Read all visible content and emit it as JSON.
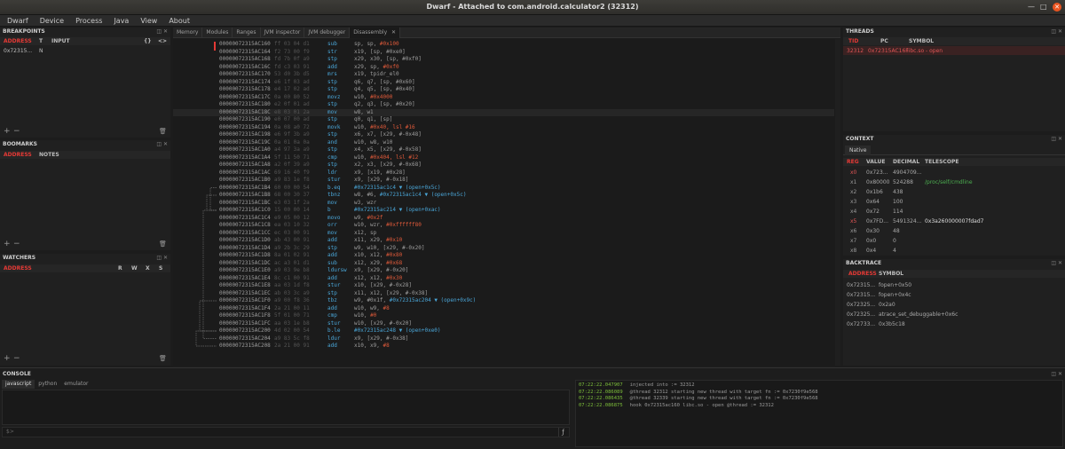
{
  "window": {
    "title": "Dwarf - Attached to com.android.calculator2 (32312)"
  },
  "menu": [
    "Dwarf",
    "Device",
    "Process",
    "Java",
    "View",
    "About"
  ],
  "breakpoints": {
    "title": "BREAKPOINTS",
    "cols": [
      "ADDRESS",
      "T",
      "INPUT"
    ],
    "rows": [
      {
        "address": "0x72315...",
        "t": "N"
      }
    ],
    "add": "+",
    "remove": "−"
  },
  "bookmarks": {
    "title": "BOOMARKS",
    "cols": [
      "ADDRESS",
      "NOTES"
    ],
    "add": "+",
    "remove": "−"
  },
  "watchers": {
    "title": "WATCHERS",
    "cols": [
      "ADDRESS",
      "R",
      "W",
      "X",
      "S"
    ],
    "add": "+",
    "remove": "−"
  },
  "tabs": [
    "Memory",
    "Modules",
    "Ranges",
    "JVM inspector",
    "JVM debugger",
    "Disassembly"
  ],
  "disassembly": [
    {
      "addr": "00000072315AC160",
      "bytes": "ff 03 04 d1",
      "mn": "sub",
      "op": "sp, sp, ",
      "imm": "#0x100",
      "tail": ""
    },
    {
      "addr": "00000072315AC164",
      "bytes": "f2 73 00 f9",
      "mn": "str",
      "op": "x19, [sp, #0xe0]",
      "imm": "",
      "tail": ""
    },
    {
      "addr": "00000072315AC168",
      "bytes": "fd 7b 0f a9",
      "mn": "stp",
      "op": "x29, x30, [sp, #0xf0]",
      "imm": "",
      "tail": ""
    },
    {
      "addr": "00000072315AC16C",
      "bytes": "fd c3 03 91",
      "mn": "add",
      "op": "x29, sp, ",
      "imm": "#0xf0",
      "tail": ""
    },
    {
      "addr": "00000072315AC170",
      "bytes": "53 d0 3b d5",
      "mn": "mrs",
      "op": "x19, tpidr_el0",
      "imm": "",
      "tail": ""
    },
    {
      "addr": "00000072315AC174",
      "bytes": "e6 1f 03 ad",
      "mn": "stp",
      "op": "q6, q7, [sp, #0x60]",
      "imm": "",
      "tail": ""
    },
    {
      "addr": "00000072315AC178",
      "bytes": "e4 17 02 ad",
      "mn": "stp",
      "op": "q4, q5, [sp, #0x40]",
      "imm": "",
      "tail": ""
    },
    {
      "addr": "00000072315AC17C",
      "bytes": "0a 00 80 52",
      "mn": "movz",
      "op": "w10, ",
      "imm": "#0x4000",
      "tail": ""
    },
    {
      "addr": "00000072315AC180",
      "bytes": "e2 0f 01 ad",
      "mn": "stp",
      "op": "q2, q3, [sp, #0x20]",
      "imm": "",
      "tail": ""
    },
    {
      "addr": "00000072315AC18C",
      "bytes": "e8 03 01 2a",
      "mn": "mov",
      "op": "w8, w1",
      "imm": "",
      "tail": ""
    },
    {
      "addr": "00000072315AC190",
      "bytes": "e0 07 00 ad",
      "mn": "stp",
      "op": "q0, q1, [sp]",
      "imm": "",
      "tail": ""
    },
    {
      "addr": "00000072315AC194",
      "bytes": "0a 08 a0 72",
      "mn": "movk",
      "op": "w10, ",
      "imm": "#0x40, lsl #16",
      "tail": ""
    },
    {
      "addr": "00000072315AC198",
      "bytes": "e6 9f 3b a9",
      "mn": "stp",
      "op": "x6, x7, [x29, #-0x48]",
      "imm": "",
      "tail": ""
    },
    {
      "addr": "00000072315AC19C",
      "bytes": "0a 01 0a 0a",
      "mn": "and",
      "op": "w10, w8, w10",
      "imm": "",
      "tail": ""
    },
    {
      "addr": "00000072315AC1A0",
      "bytes": "a4 97 3a a9",
      "mn": "stp",
      "op": "x4, x5, [x29, #-0x58]",
      "imm": "",
      "tail": ""
    },
    {
      "addr": "00000072315AC1A4",
      "bytes": "5f 11 50 71",
      "mn": "cmp",
      "op": "w10, ",
      "imm": "#0x404, lsl #12",
      "tail": ""
    },
    {
      "addr": "00000072315AC1A8",
      "bytes": "a2 0f 39 a9",
      "mn": "stp",
      "op": "x2, x3, [x29, #-0x68]",
      "imm": "",
      "tail": ""
    },
    {
      "addr": "00000072315AC1AC",
      "bytes": "69 16 40 f9",
      "mn": "ldr",
      "op": "x9, [x19, #0x28]",
      "imm": "",
      "tail": ""
    },
    {
      "addr": "00000072315AC1B0",
      "bytes": "a9 83 1e f8",
      "mn": "stur",
      "op": "x9, [x29, #-0x18]",
      "imm": "",
      "tail": ""
    },
    {
      "addr": "00000072315AC1B4",
      "bytes": "60 00 00 54",
      "mn": "b.eq",
      "op": "",
      "imm": "",
      "tail": "#0x72315ac1c4 ▼ (open+0x5c)"
    },
    {
      "addr": "00000072315AC1B8",
      "bytes": "68 00 30 37",
      "mn": "tbnz",
      "op": "w8, #6, ",
      "imm": "",
      "tail": "#0x72315ac1c4 ▼ (open+0x5c)"
    },
    {
      "addr": "00000072315AC1BC",
      "bytes": "e3 03 1f 2a",
      "mn": "mov",
      "op": "w3, wzr",
      "imm": "",
      "tail": ""
    },
    {
      "addr": "00000072315AC1C0",
      "bytes": "15 00 00 14",
      "mn": "b",
      "op": "",
      "imm": "",
      "tail": "#0x72315ac214 ▼ (open+0xac)"
    },
    {
      "addr": "00000072315AC1C4",
      "bytes": "e9 05 00 12",
      "mn": "movo",
      "op": "w9, ",
      "imm": "#0x2f",
      "tail": ""
    },
    {
      "addr": "00000072315AC1C8",
      "bytes": "ea 03 10 32",
      "mn": "orr",
      "op": "w10, wzr, ",
      "imm": "#0xffffff80",
      "tail": ""
    },
    {
      "addr": "00000072315AC1CC",
      "bytes": "ec 03 00 91",
      "mn": "mov",
      "op": "x12, sp",
      "imm": "",
      "tail": ""
    },
    {
      "addr": "00000072315AC1D0",
      "bytes": "ab 43 00 91",
      "mn": "add",
      "op": "x11, x29, ",
      "imm": "#0x10",
      "tail": ""
    },
    {
      "addr": "00000072315AC1D4",
      "bytes": "a9 2b 3c 29",
      "mn": "stp",
      "op": "w9, w10, [x29, #-0x20]",
      "imm": "",
      "tail": ""
    },
    {
      "addr": "00000072315AC1D8",
      "bytes": "8a 01 02 91",
      "mn": "add",
      "op": "x10, x12, ",
      "imm": "#0x80",
      "tail": ""
    },
    {
      "addr": "00000072315AC1DC",
      "bytes": "ac a3 01 d1",
      "mn": "sub",
      "op": "x12, x29, ",
      "imm": "#0x68",
      "tail": ""
    },
    {
      "addr": "00000072315AC1E0",
      "bytes": "a9 03 9e b8",
      "mn": "ldursw",
      "op": "x9, [x29, #-0x20]",
      "imm": "",
      "tail": ""
    },
    {
      "addr": "00000072315AC1E4",
      "bytes": "8c c1 00 91",
      "mn": "add",
      "op": "x12, x12, ",
      "imm": "#0x30",
      "tail": ""
    },
    {
      "addr": "00000072315AC1E8",
      "bytes": "aa 03 1d f8",
      "mn": "stur",
      "op": "x10, [x29, #-0x28]",
      "imm": "",
      "tail": ""
    },
    {
      "addr": "00000072315AC1EC",
      "bytes": "ab 03 3c a9",
      "mn": "stp",
      "op": "x11, x12, [x29, #-0x38]",
      "imm": "",
      "tail": ""
    },
    {
      "addr": "00000072315AC1F0",
      "bytes": "a9 00 f8 36",
      "mn": "tbz",
      "op": "w9, #0x1f, ",
      "imm": "",
      "tail": "#0x72315ac204 ▼ (open+0x9c)"
    },
    {
      "addr": "00000072315AC1F4",
      "bytes": "2a 21 00 11",
      "mn": "add",
      "op": "w10, w9, ",
      "imm": "#8",
      "tail": ""
    },
    {
      "addr": "00000072315AC1F8",
      "bytes": "5f 01 00 71",
      "mn": "cmp",
      "op": "w10, ",
      "imm": "#0",
      "tail": ""
    },
    {
      "addr": "00000072315AC1FC",
      "bytes": "aa 03 1e b8",
      "mn": "stur",
      "op": "w10, [x29, #-0x20]",
      "imm": "",
      "tail": ""
    },
    {
      "addr": "00000072315AC200",
      "bytes": "4d 02 00 54",
      "mn": "b.le",
      "op": "",
      "imm": "",
      "tail": "#0x72315ac248 ▼ (open+0xe0)"
    },
    {
      "addr": "00000072315AC204",
      "bytes": "a9 83 5c f8",
      "mn": "ldur",
      "op": "x9, [x29, #-0x38]",
      "imm": "",
      "tail": ""
    },
    {
      "addr": "00000072315AC208",
      "bytes": "2a 21 00 91",
      "mn": "add",
      "op": "x10, x9, ",
      "imm": "#8",
      "tail": ""
    }
  ],
  "threads": {
    "title": "THREADS",
    "cols": [
      "TID",
      "PC",
      "SYMBOL"
    ],
    "rows": [
      {
        "tid": "32312",
        "pc": "0x72315AC16F",
        "symbol": "libc.so - open"
      }
    ]
  },
  "context": {
    "title": "CONTEXT",
    "tab": "Native",
    "cols": [
      "REG",
      "VALUE",
      "DECIMAL",
      "TELESCOPE"
    ],
    "rows": [
      {
        "reg": "x0",
        "value": "0x723...",
        "dec": "4904709...",
        "tel": "",
        "red": true
      },
      {
        "reg": "x1",
        "value": "0x80000",
        "dec": "524288",
        "tel": "/proc/self/cmdline",
        "red": false
      },
      {
        "reg": "x2",
        "value": "0x1b6",
        "dec": "438",
        "tel": "",
        "red": false
      },
      {
        "reg": "x3",
        "value": "0x64",
        "dec": "100",
        "tel": "",
        "red": false
      },
      {
        "reg": "x4",
        "value": "0x72",
        "dec": "114",
        "tel": "",
        "red": false
      },
      {
        "reg": "x5",
        "value": "0x7FD...",
        "dec": "5491324...",
        "tel": "0x3a260000007fdad7",
        "red": true
      },
      {
        "reg": "x6",
        "value": "0x30",
        "dec": "48",
        "tel": "",
        "red": false
      },
      {
        "reg": "x7",
        "value": "0x0",
        "dec": "0",
        "tel": "",
        "red": false
      },
      {
        "reg": "x8",
        "value": "0x4",
        "dec": "4",
        "tel": "",
        "red": false
      }
    ]
  },
  "backtrace": {
    "title": "BACKTRACE",
    "cols": [
      "ADDRESS",
      "SYMBOL"
    ],
    "rows": [
      {
        "addr": "0x72315...",
        "sym": "fopen+0x50"
      },
      {
        "addr": "0x72315...",
        "sym": "fopen+0x4c"
      },
      {
        "addr": "0x72325...",
        "sym": "0x2a0"
      },
      {
        "addr": "0x72325...",
        "sym": "atrace_set_debuggable+0x6c"
      },
      {
        "addr": "0x72733...",
        "sym": "0x3b5c18"
      }
    ]
  },
  "console": {
    "title": "CONSOLE",
    "tabs": [
      "javascript",
      "python",
      "emulator"
    ],
    "prompt": "$>",
    "run": "ƒ",
    "log": [
      {
        "ts": "07:22:22.047907",
        "msg": "injected into := 32312"
      },
      {
        "ts": "07:22:22.086089",
        "msg": "@thread 32312 starting new thread with target fn := 0x7230f9e568"
      },
      {
        "ts": "07:22:22.086435",
        "msg": "@thread 32339 starting new thread with target fn := 0x7230f9e568"
      },
      {
        "ts": "07:22:22.086875",
        "msg": "hook 0x72315ac160 libc.so - open @thread := 32312"
      }
    ]
  }
}
